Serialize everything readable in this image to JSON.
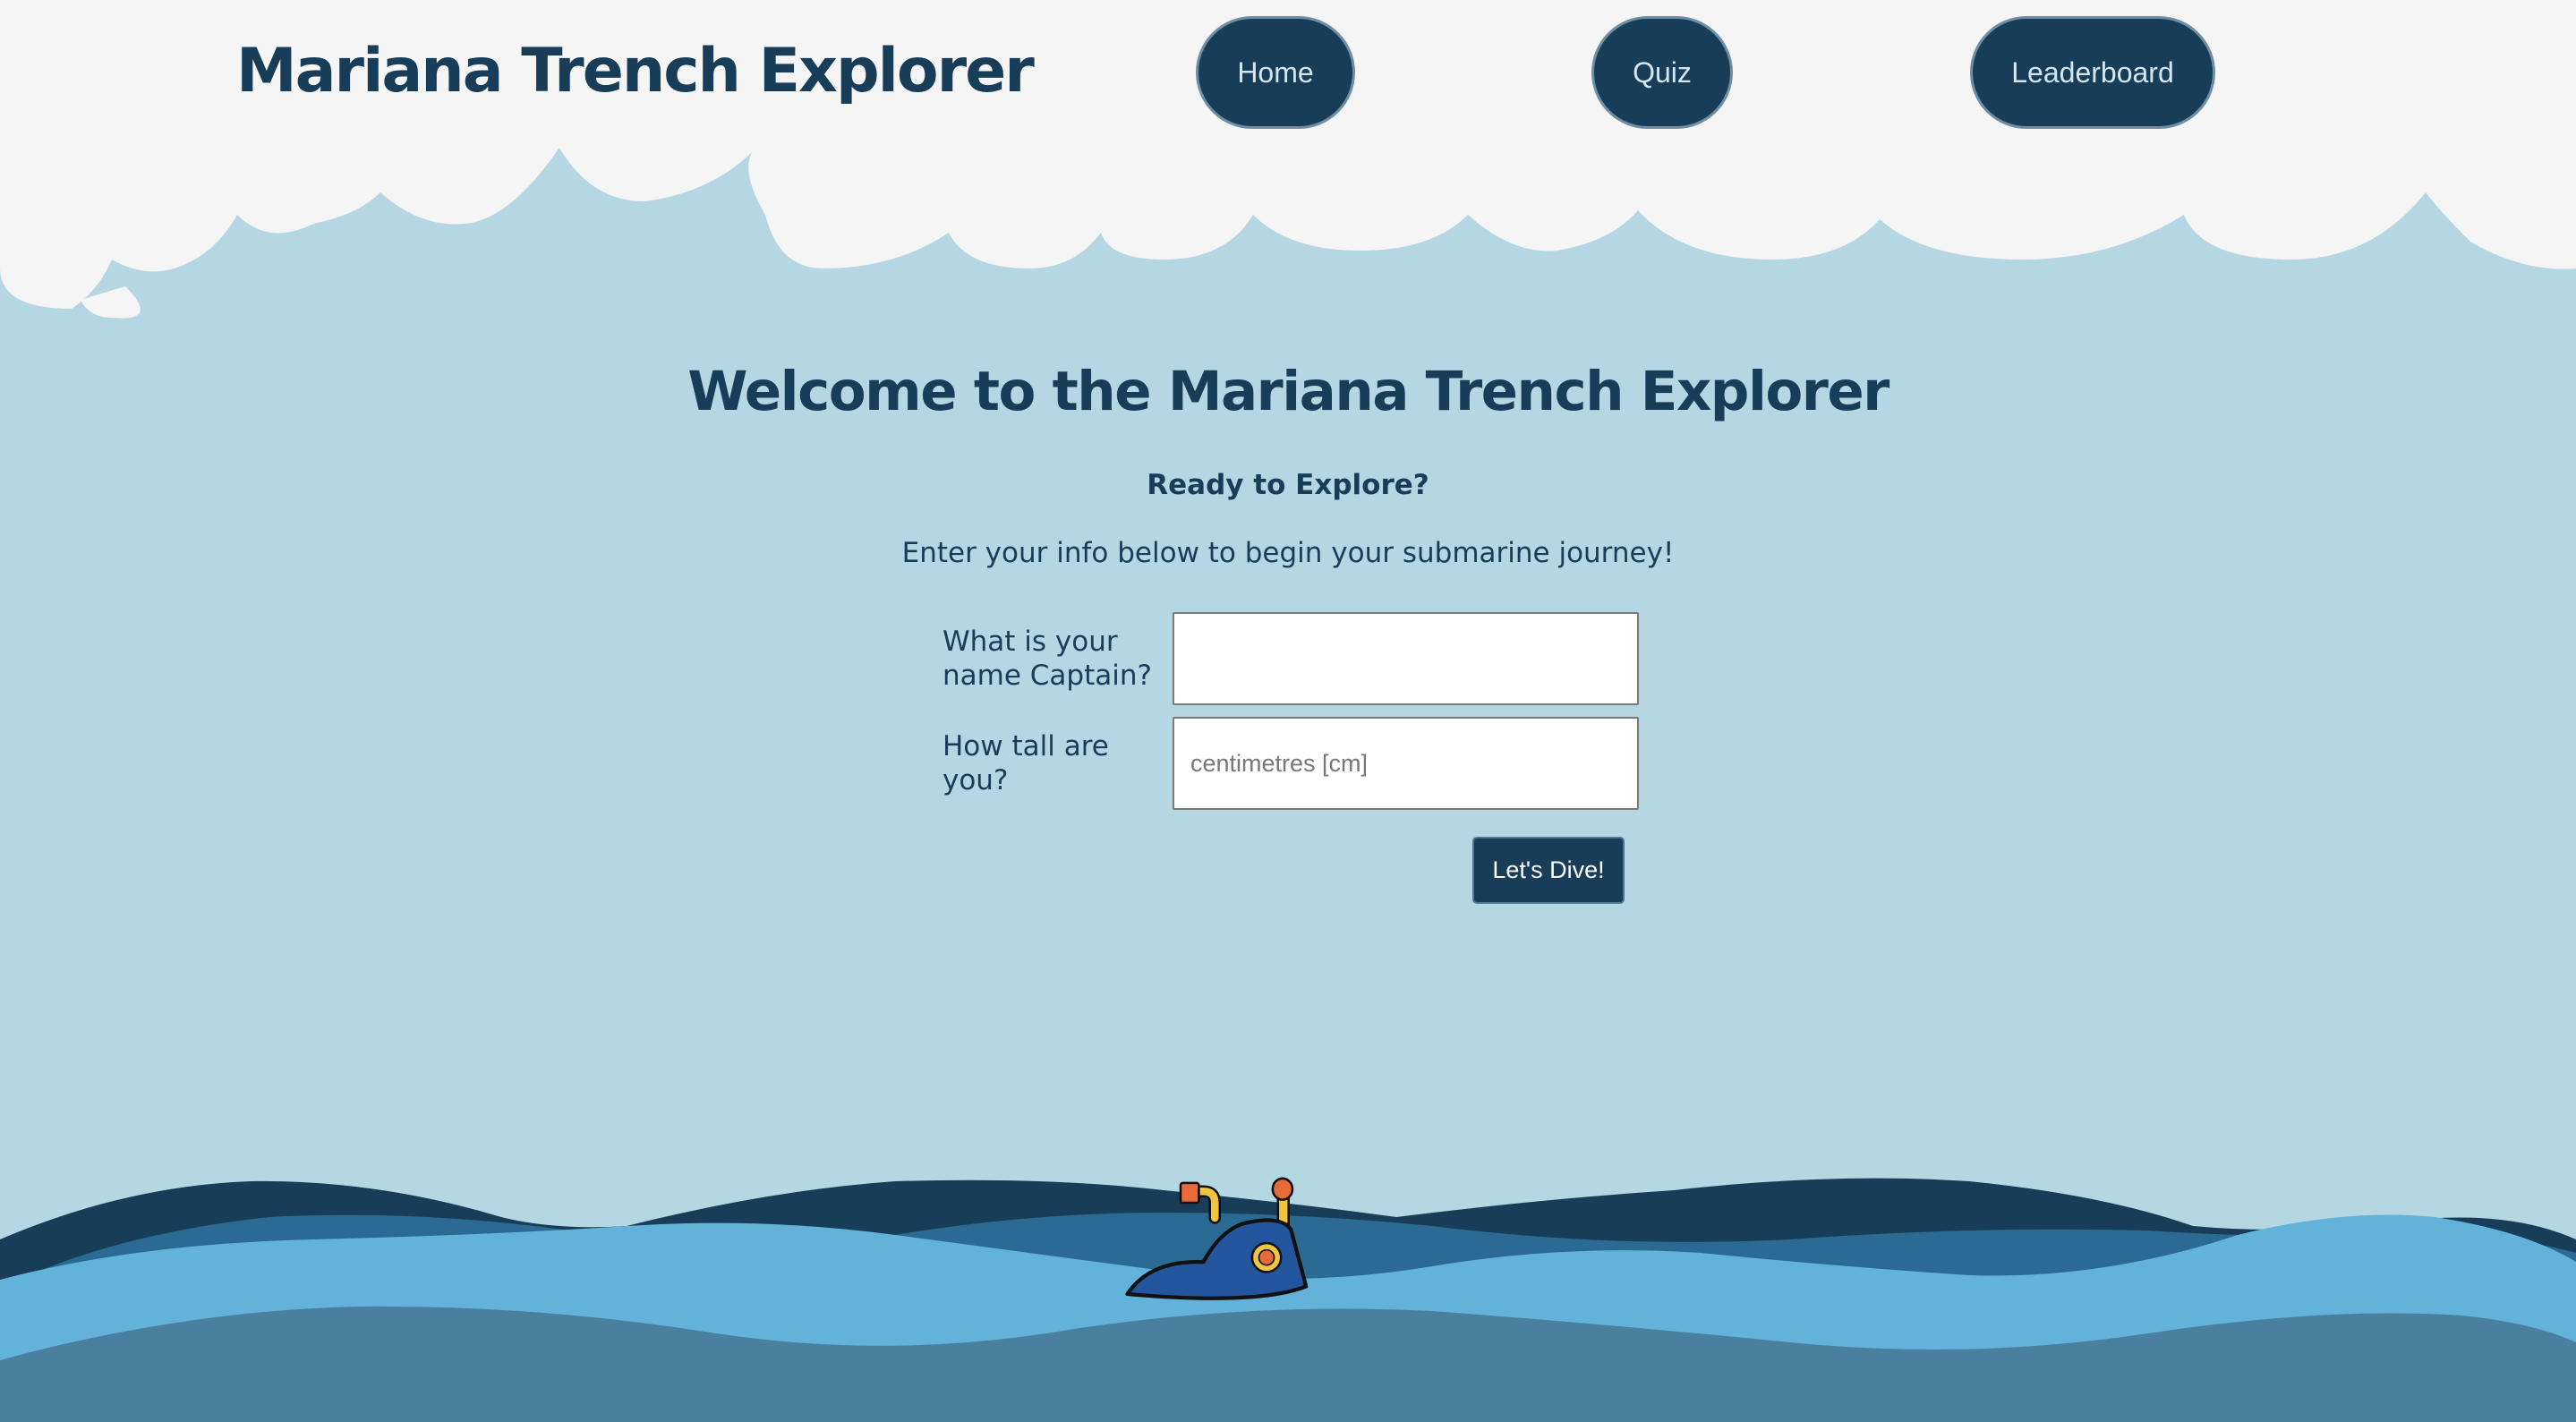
{
  "header": {
    "site_title": "Mariana Trench Explorer",
    "nav": {
      "home": "Home",
      "quiz": "Quiz",
      "leaderboard": "Leaderboard"
    }
  },
  "main": {
    "welcome_title": "Welcome to the Mariana Trench Explorer",
    "ready_heading": "Ready to Explore?",
    "intro_text": "Enter your info below to begin your submarine journey!",
    "form": {
      "name_label": "What is your name Captain?",
      "name_value": "",
      "height_label": "How tall are you?",
      "height_placeholder": "centimetres [cm]",
      "height_value": "",
      "submit_label": "Let's Dive!"
    }
  },
  "decor": {
    "cloud_icon": "cloud-bank-icon",
    "wave_icon": "ocean-waves-icon",
    "submarine_icon": "submarine-icon"
  },
  "colors": {
    "sky": "#b5d7e3",
    "cloud": "#f5f5f5",
    "navy": "#173d59",
    "wave_back": "#173d59",
    "wave_mid": "#2a6a93",
    "wave_front": "#63b2da",
    "wave_deep": "#4a7fa0",
    "submarine": "#2456a0"
  }
}
